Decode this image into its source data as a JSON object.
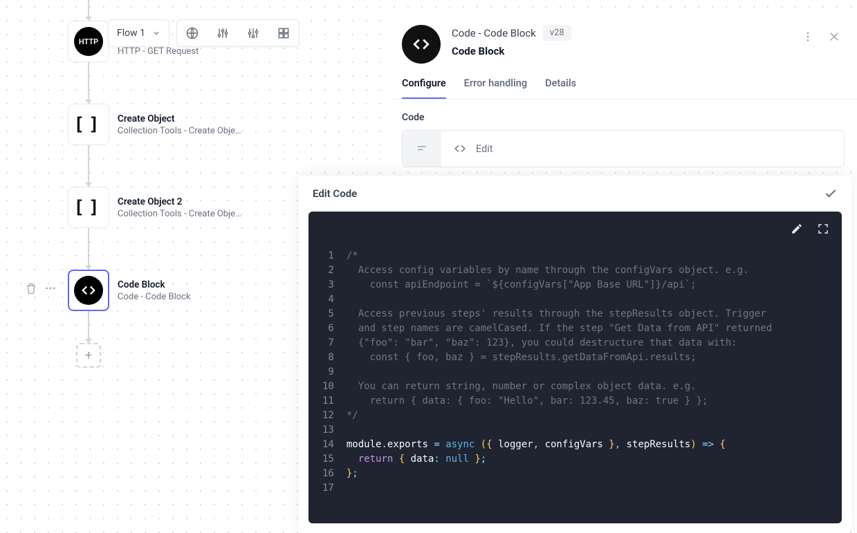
{
  "toolbar": {
    "flow_label": "Flow 1"
  },
  "nodes": [
    {
      "title": "HTTP - GET Request",
      "sub": "HTTP - GET Request",
      "icon": "http"
    },
    {
      "title": "Create Object",
      "sub": "Collection Tools - Create Obje…",
      "icon": "brackets"
    },
    {
      "title": "Create Object 2",
      "sub": "Collection Tools - Create Obje…",
      "icon": "brackets"
    },
    {
      "title": "Code Block",
      "sub": "Code - Code Block",
      "icon": "code",
      "selected": true
    }
  ],
  "panel": {
    "sup": "Code - Code Block",
    "version": "v28",
    "title": "Code Block",
    "tabs": [
      "Configure",
      "Error handling",
      "Details"
    ],
    "active_tab": 0,
    "code_label": "Code",
    "edit_label": "Edit"
  },
  "editor": {
    "title": "Edit Code",
    "lines": [
      "/*",
      "  Access config variables by name through the configVars object. e.g.",
      "    const apiEndpoint = `${configVars[\"App Base URL\"]}/api`;",
      "",
      "  Access previous steps' results through the stepResults object. Trigger",
      "  and step names are camelCased. If the step \"Get Data from API\" returned",
      "  {\"foo\": \"bar\", \"baz\": 123}, you could destructure that data with:",
      "    const { foo, baz } = stepResults.getDataFromApi.results;",
      "",
      "  You can return string, number or complex object data. e.g.",
      "    return { data: { foo: \"Hello\", bar: 123.45, baz: true } };",
      "*/",
      "",
      "module.exports = async ({ logger, configVars }, stepResults) => {",
      "  return { data: null };",
      "};",
      ""
    ]
  }
}
